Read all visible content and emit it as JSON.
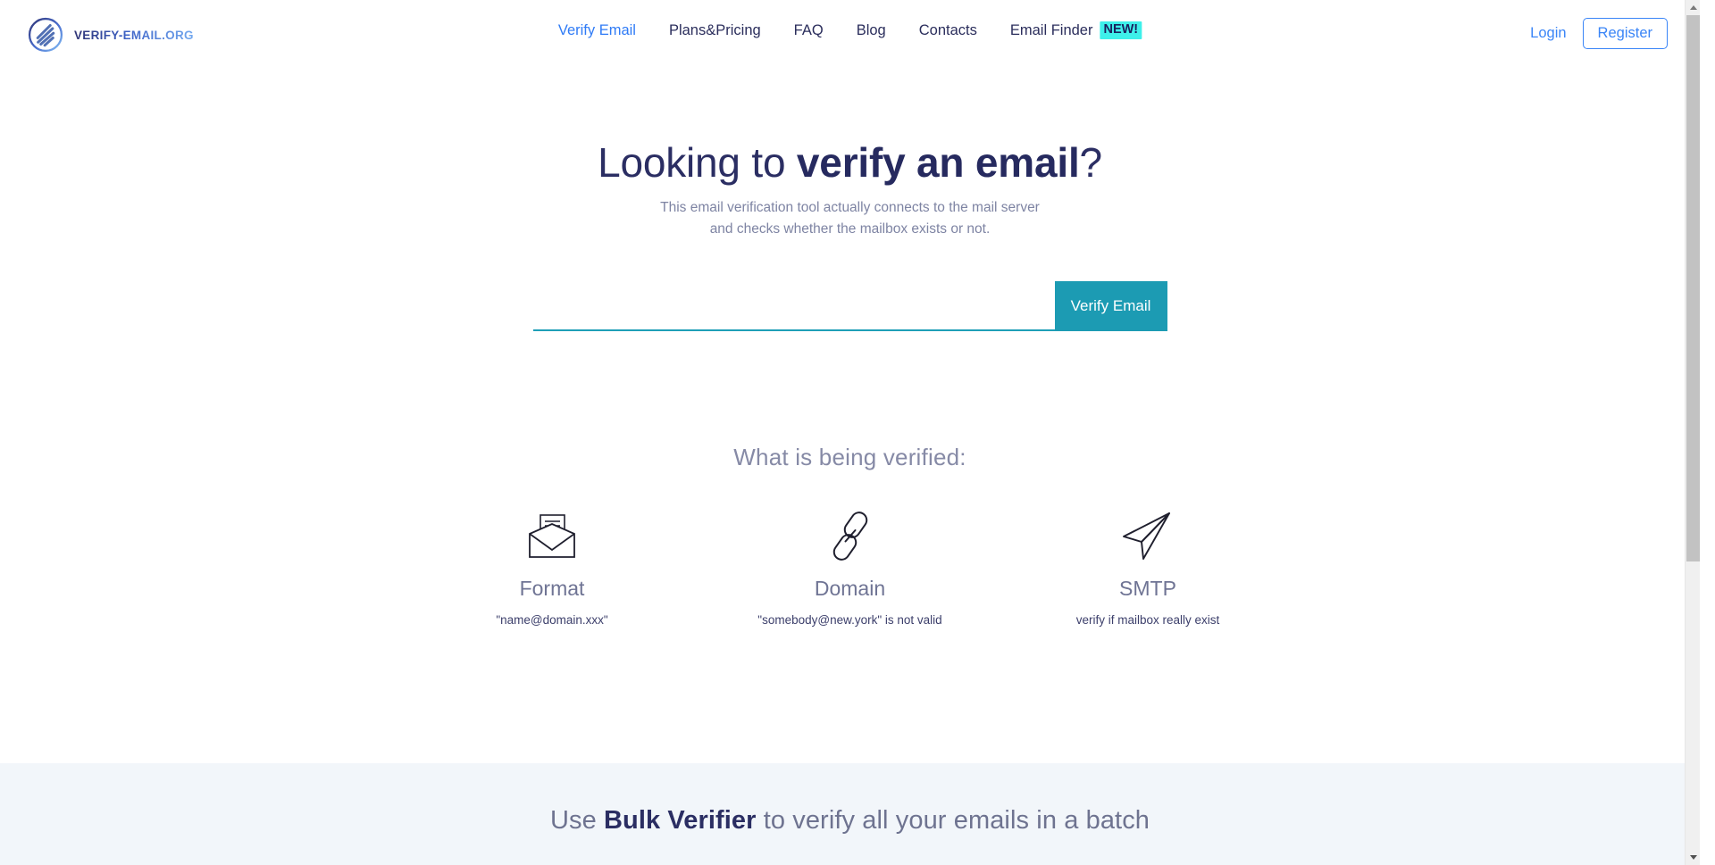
{
  "brand": {
    "name": "VERIFY-EMAIL.ORG",
    "logo_icon": "circular-swoosh-logo-icon"
  },
  "nav": {
    "items": [
      {
        "label": "Verify Email",
        "active": true
      },
      {
        "label": "Plans&Pricing",
        "active": false
      },
      {
        "label": "FAQ",
        "active": false
      },
      {
        "label": "Blog",
        "active": false
      },
      {
        "label": "Contacts",
        "active": false
      },
      {
        "label": "Email Finder",
        "active": false,
        "badge": "NEW!"
      }
    ]
  },
  "auth": {
    "login_label": "Login",
    "register_label": "Register"
  },
  "hero": {
    "title_plain_1": "Looking to ",
    "title_bold": "verify an email",
    "title_plain_2": "?",
    "subtitle_line1": "This email verification tool actually connects to the mail server",
    "subtitle_line2": "and checks whether the mailbox exists or not."
  },
  "search": {
    "value": "",
    "placeholder": "",
    "button_label": "Verify Email"
  },
  "features": {
    "heading": "What is being verified:",
    "items": [
      {
        "title": "Format",
        "description": "\"name@domain.xxx\"",
        "icon": "open-envelope-icon"
      },
      {
        "title": "Domain",
        "description": "\"somebody@new.york\" is not valid",
        "icon": "chain-link-icon"
      },
      {
        "title": "SMTP",
        "description": "verify if mailbox really exist",
        "icon": "paper-plane-icon"
      }
    ]
  },
  "bulk": {
    "title_plain_1": "Use ",
    "title_bold": "Bulk Verifier",
    "title_plain_2": " to verify all your emails in a batch"
  },
  "colors": {
    "accent_teal": "#1c9bb3",
    "accent_blue": "#3a85f7",
    "badge_cyan": "#3ef0ea",
    "navy": "#2b2e63",
    "section_bg": "#f2f6fa"
  }
}
